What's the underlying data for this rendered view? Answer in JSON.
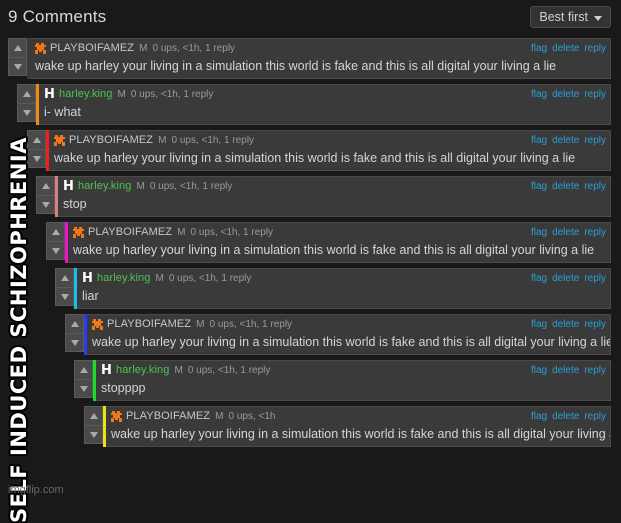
{
  "header": {
    "title": "9 Comments",
    "sort_label": "Best first",
    "sort_icon": "chevron-down-icon"
  },
  "watermark": "imgflip.com",
  "meme_caption": "SELF INDUCED SCHIZOPHRENIA",
  "colors": {
    "page_background": "#191919",
    "comment_background": "#3a3a3a",
    "link": "#2a9fd6",
    "harley_username": "#4fc24f",
    "playboi_username": "#c7c7c7"
  },
  "actions": {
    "flag": "flag",
    "delete": "delete",
    "reply": "reply"
  },
  "comments": [
    {
      "username": "PLAYBOIFAMEZ",
      "user_class": "user-playboi",
      "avatar": "orange-figure-avatar",
      "badge": "M",
      "meta": "0 ups, <1h, 1 reply",
      "text": "wake up harley your living in a simulation this world is fake and this is all digital your living a lie",
      "indent": 8,
      "accent": "#3a3a3a"
    },
    {
      "username": "harley.king",
      "user_class": "user-harley",
      "avatar": "letter-h-avatar",
      "badge": "M",
      "meta": "0 ups, <1h, 1 reply",
      "text": "i- what",
      "indent": 17,
      "accent": "#f08a18"
    },
    {
      "username": "PLAYBOIFAMEZ",
      "user_class": "user-playboi",
      "avatar": "orange-figure-avatar",
      "badge": "M",
      "meta": "0 ups, <1h, 1 reply",
      "text": "wake up harley your living in a simulation this world is fake and this is all digital your living a lie",
      "indent": 27,
      "accent": "#f02020"
    },
    {
      "username": "harley.king",
      "user_class": "user-harley",
      "avatar": "letter-h-avatar",
      "badge": "M",
      "meta": "0 ups, <1h, 1 reply",
      "text": "stop",
      "indent": 36,
      "accent": "#d98080"
    },
    {
      "username": "PLAYBOIFAMEZ",
      "user_class": "user-playboi",
      "avatar": "orange-figure-avatar",
      "badge": "M",
      "meta": "0 ups, <1h, 1 reply",
      "text": "wake up harley your living in a simulation this world is fake and this is all digital your living a lie",
      "indent": 46,
      "accent": "#f012c8"
    },
    {
      "username": "harley.king",
      "user_class": "user-harley",
      "avatar": "letter-h-avatar",
      "badge": "M",
      "meta": "0 ups, <1h, 1 reply",
      "text": "liar",
      "indent": 55,
      "accent": "#16c0e8"
    },
    {
      "username": "PLAYBOIFAMEZ",
      "user_class": "user-playboi",
      "avatar": "orange-figure-avatar",
      "badge": "M",
      "meta": "0 ups, <1h, 1 reply",
      "text": "wake up harley your living in a simulation this world is fake and this is all digital your living a lie",
      "indent": 65,
      "accent": "#2a3cf0"
    },
    {
      "username": "harley.king",
      "user_class": "user-harley",
      "avatar": "letter-h-avatar",
      "badge": "M",
      "meta": "0 ups, <1h, 1 reply",
      "text": "stopppp",
      "indent": 74,
      "accent": "#16e020"
    },
    {
      "username": "PLAYBOIFAMEZ",
      "user_class": "user-playboi",
      "avatar": "orange-figure-avatar",
      "badge": "M",
      "meta": "0 ups, <1h",
      "text": "wake up harley your living in a simulation this world is fake and this is all digital your living a lie",
      "indent": 84,
      "accent": "#f0e018"
    }
  ]
}
